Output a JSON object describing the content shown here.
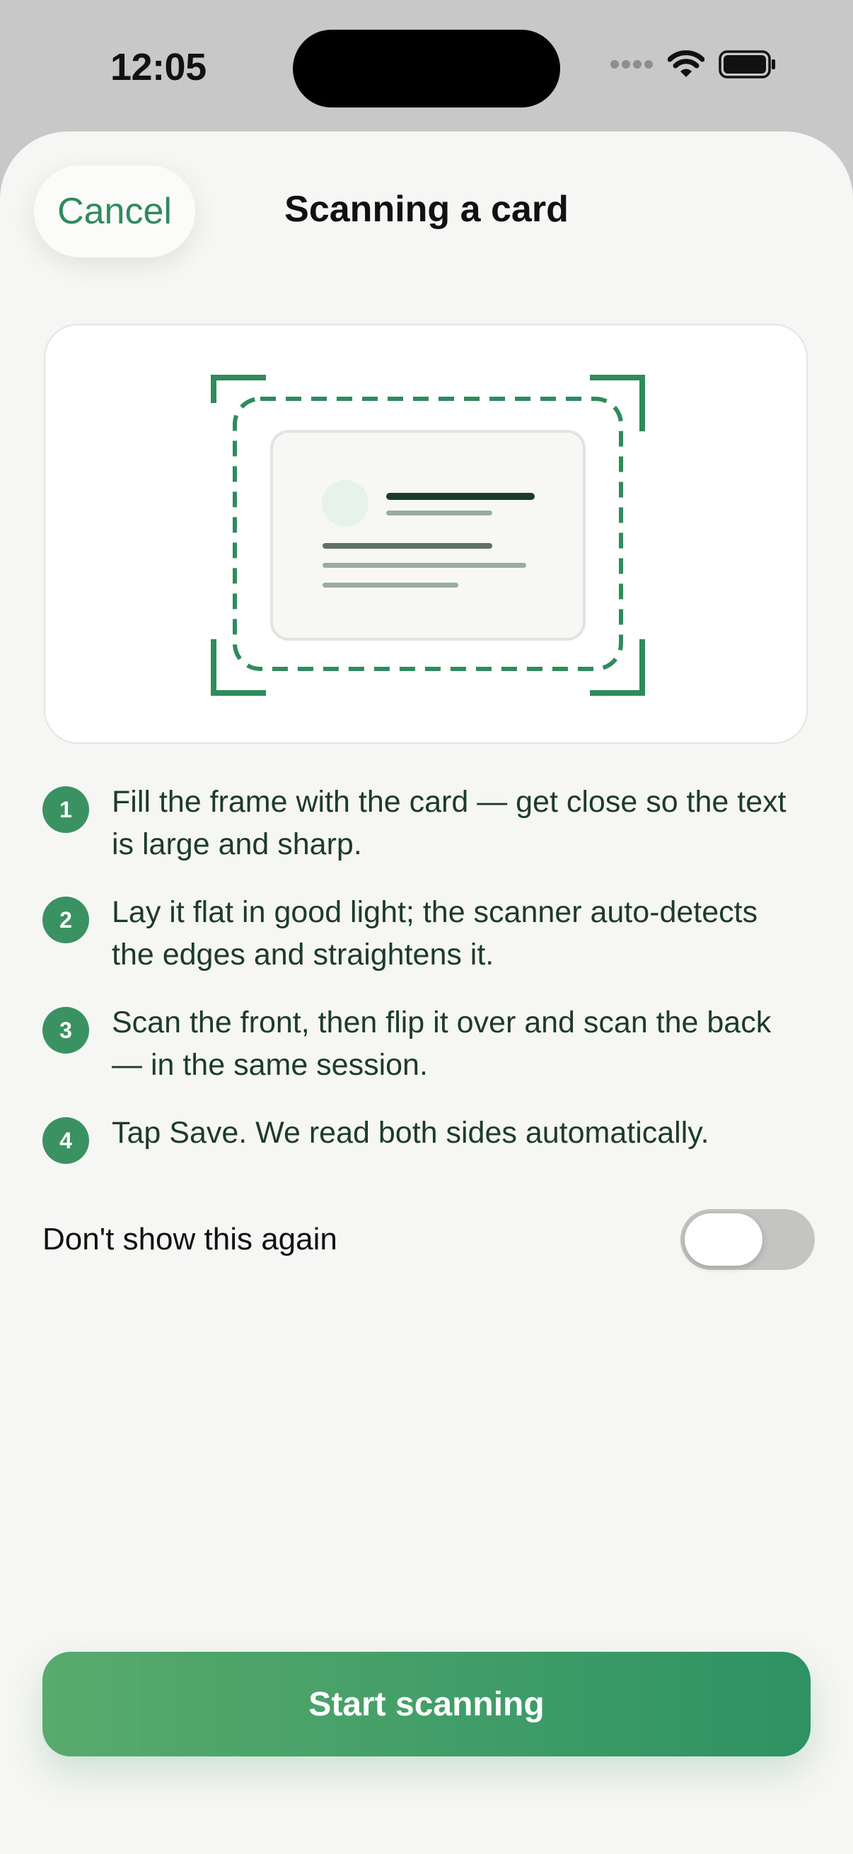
{
  "status_bar": {
    "time": "12:05",
    "icons": [
      "signal-dots-icon",
      "wifi-icon",
      "battery-icon"
    ]
  },
  "header": {
    "cancel_label": "Cancel",
    "title": "Scanning a card"
  },
  "illustration": {
    "icon": "card-scan-illustration-icon",
    "accent_color": "#2f8a5c"
  },
  "steps": [
    {
      "number": "1",
      "text": "Fill the frame with the card — get close so the text is large and sharp."
    },
    {
      "number": "2",
      "text": "Lay it flat in good light; the scanner auto-detects the edges and straightens it."
    },
    {
      "number": "3",
      "text": "Scan the front, then flip it over and scan the back — in the same session."
    },
    {
      "number": "4",
      "text": "Tap Save. We read both sides automatically."
    }
  ],
  "toggle": {
    "label": "Don't show this again",
    "on": false
  },
  "primary_button": {
    "label": "Start scanning"
  },
  "colors": {
    "accent": "#2f8a5c",
    "button_gradient_start": "#58ab6c",
    "button_gradient_end": "#2e9264",
    "background": "#f6f6f4"
  }
}
